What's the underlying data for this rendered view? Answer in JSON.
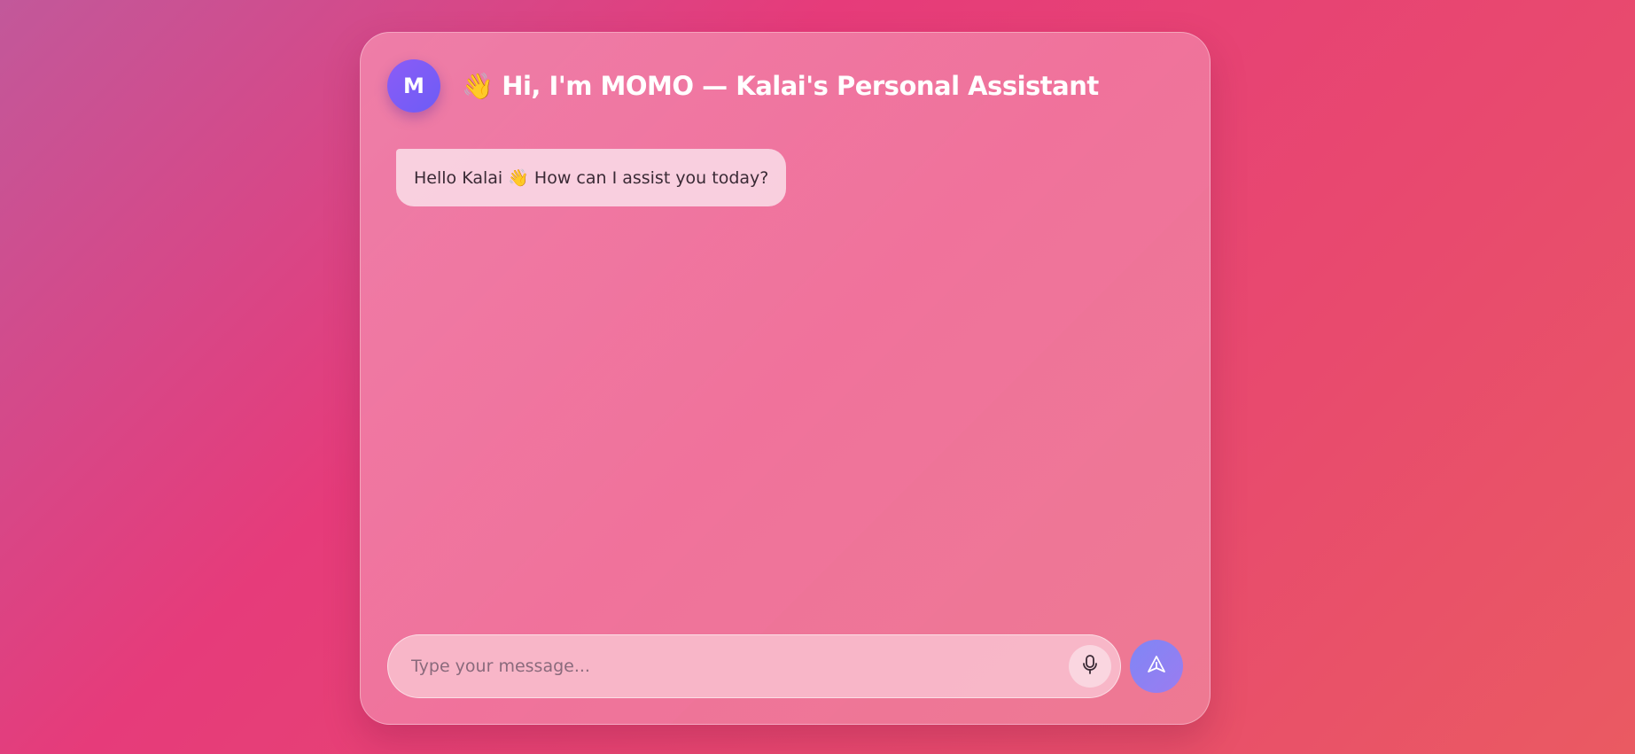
{
  "header": {
    "avatar_letter": "M",
    "title": "👋 Hi, I'm MOMO — Kalai's Personal Assistant"
  },
  "messages": [
    {
      "sender": "assistant",
      "text": "Hello Kalai 👋 How can I assist you today?"
    }
  ],
  "composer": {
    "placeholder": "Type your message...",
    "value": ""
  },
  "icons": {
    "mic": "microphone-icon",
    "send": "send-icon"
  }
}
